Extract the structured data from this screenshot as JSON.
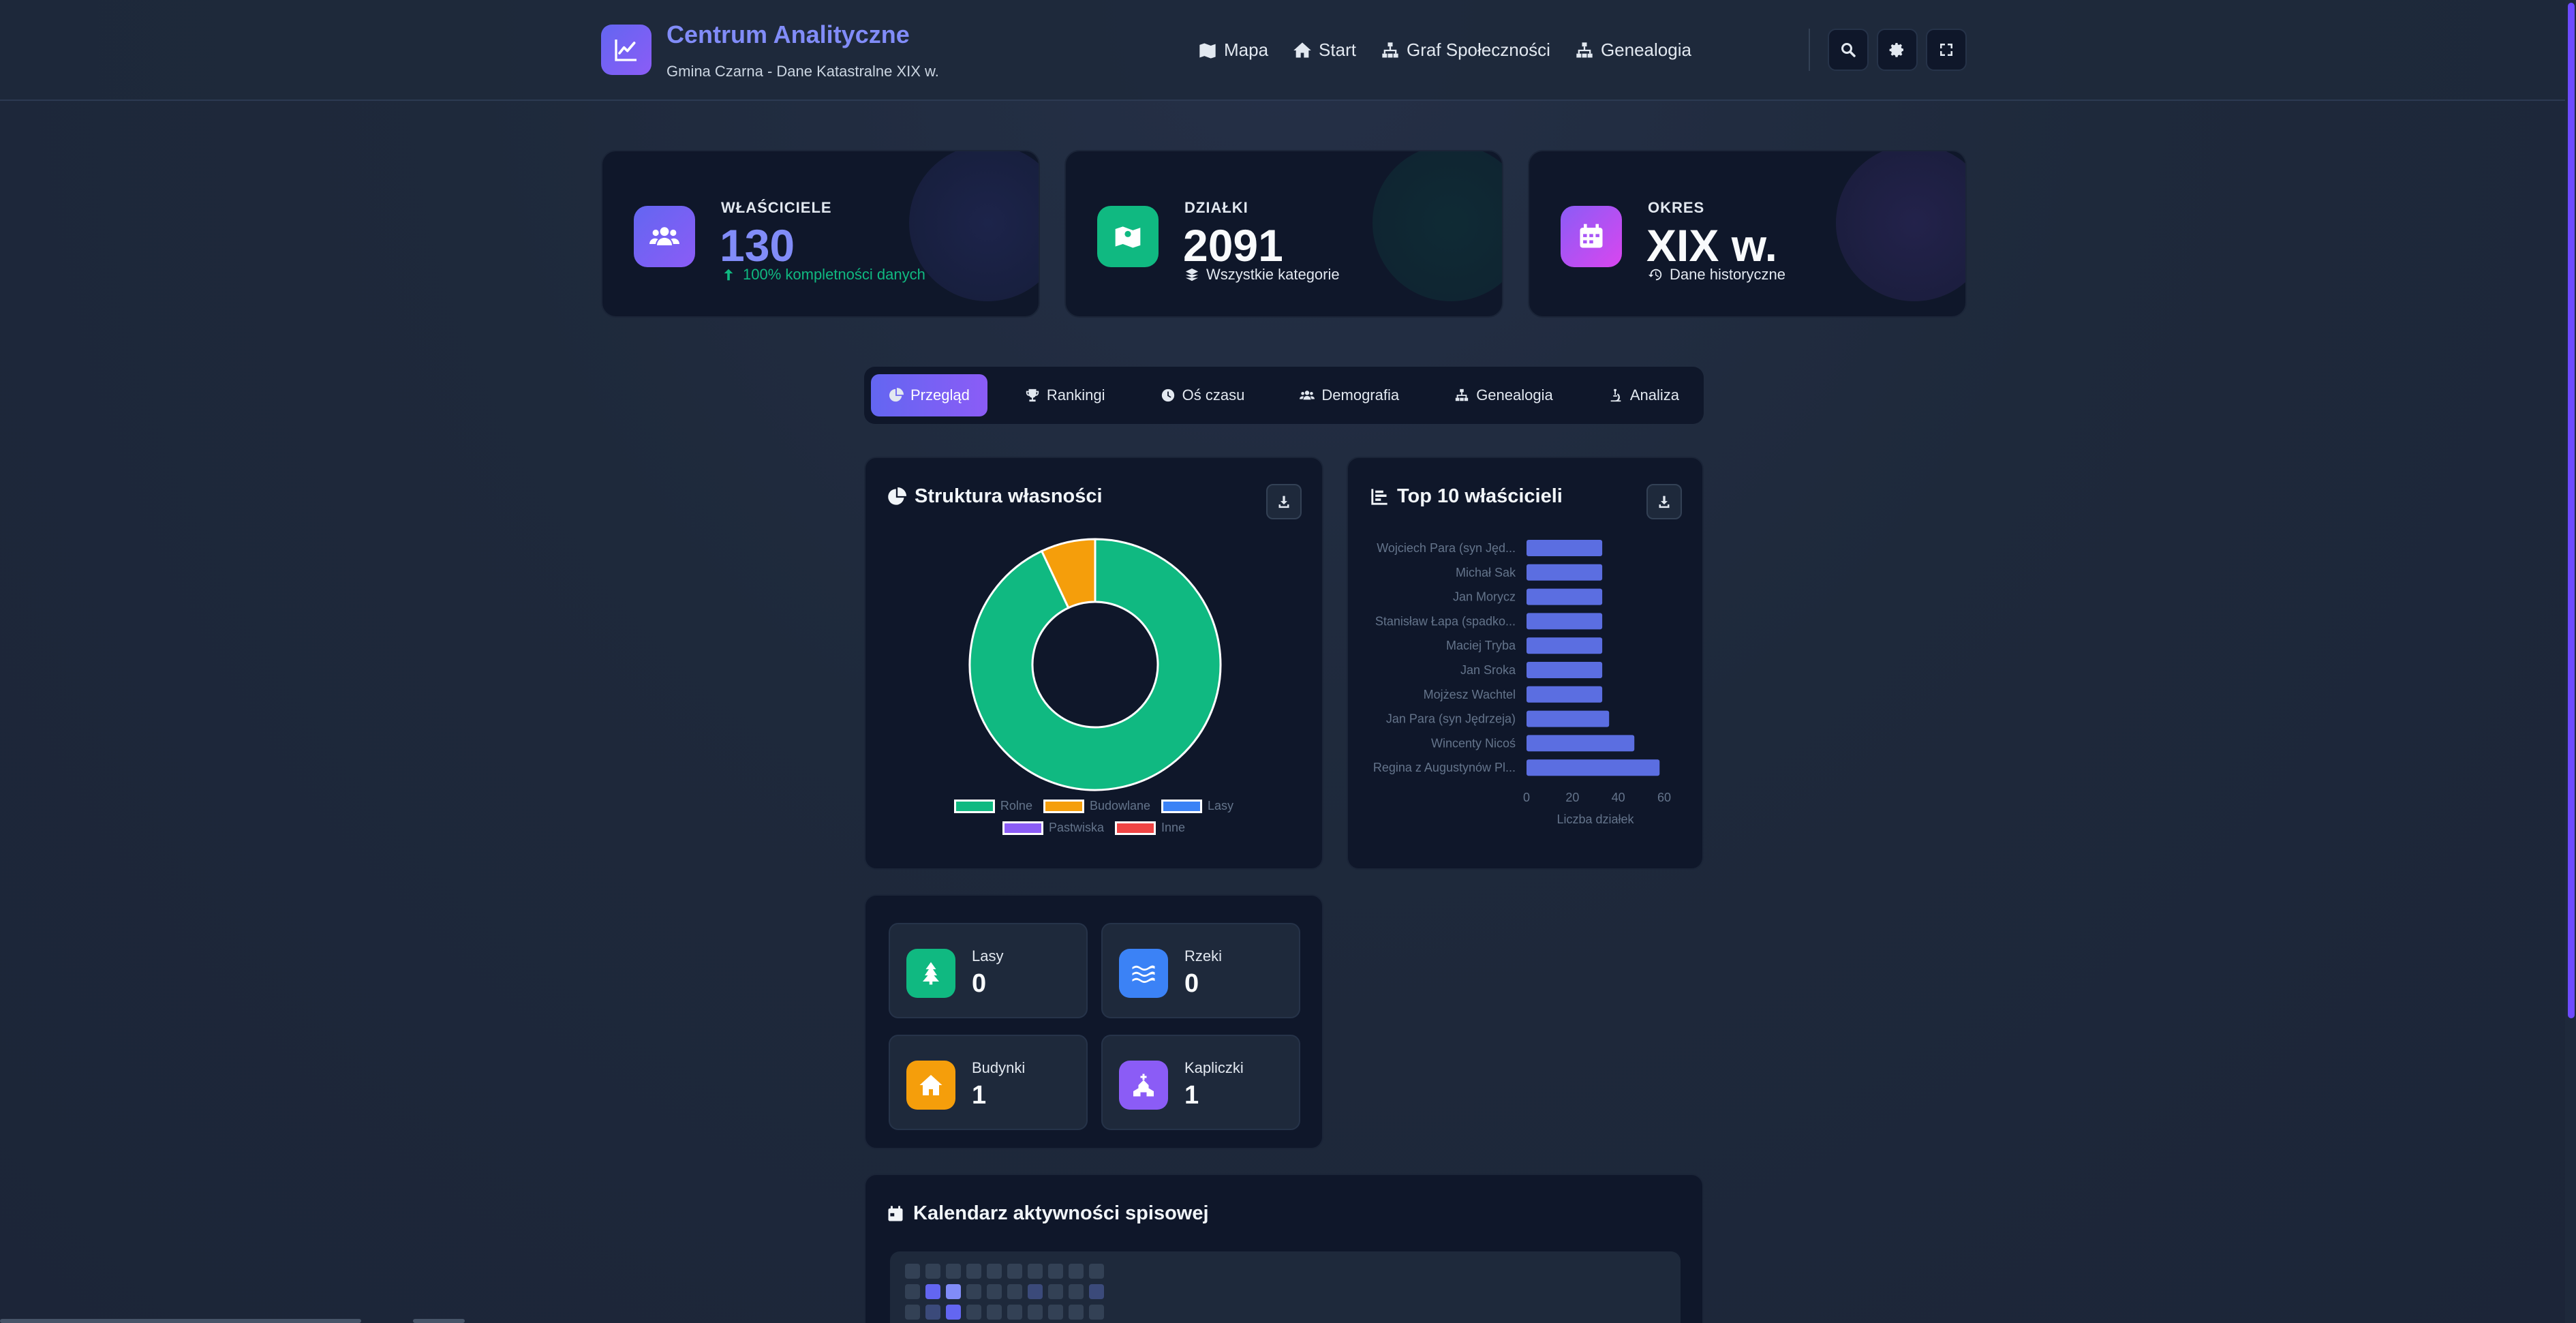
{
  "header": {
    "title": "Centrum Analityczne",
    "subtitle": "Gmina Czarna - Dane Katastralne XIX w.",
    "nav": [
      {
        "label": "Mapa",
        "icon": "map-icon"
      },
      {
        "label": "Start",
        "icon": "home-icon"
      },
      {
        "label": "Graf Społeczności",
        "icon": "sitemap-icon"
      },
      {
        "label": "Genealogia",
        "icon": "sitemap-icon"
      }
    ],
    "tools": [
      "search-icon",
      "gear-icon",
      "fullscreen-icon"
    ]
  },
  "stats": [
    {
      "label": "WŁAŚCICIELE",
      "value": "130",
      "sub": "100% kompletności danych",
      "accent": "#6366f1",
      "value_color": "#818cf8",
      "sub_color": "#10b981"
    },
    {
      "label": "DZIAŁKI",
      "value": "2091",
      "sub": "Wszystkie kategorie",
      "accent": "#10b981",
      "value_color": "#f8fafc",
      "sub_color": "#e2e8f0"
    },
    {
      "label": "OKRES",
      "value": "XIX w.",
      "sub": "Dane historyczne",
      "accent": "#8b5cf6",
      "value_color": "#f8fafc",
      "sub_color": "#e2e8f0"
    }
  ],
  "tabs": [
    {
      "label": "Przegląd",
      "active": true
    },
    {
      "label": "Rankingi",
      "active": false
    },
    {
      "label": "Oś czasu",
      "active": false
    },
    {
      "label": "Demografia",
      "active": false
    },
    {
      "label": "Genealogia",
      "active": false
    },
    {
      "label": "Analiza",
      "active": false
    }
  ],
  "ownership_panel": {
    "title": "Struktura własności"
  },
  "top_panel": {
    "title": "Top 10 właścicieli"
  },
  "chart_data": [
    {
      "type": "pie",
      "title": "Struktura własności",
      "categories": [
        "Rolne",
        "Budowlane",
        "Lasy",
        "Pastwiska",
        "Inne"
      ],
      "values": [
        93,
        7,
        0,
        0,
        0
      ],
      "colors": [
        "#10b981",
        "#f59e0b",
        "#3b82f6",
        "#8b5cf6",
        "#ef4444"
      ],
      "legend": "bottom"
    },
    {
      "type": "bar",
      "title": "Top 10 właścicieli",
      "orientation": "horizontal",
      "categories": [
        "Wojciech Para (syn Jęd...",
        "Michał Sak",
        "Jan Morycz",
        "Stanisław Łapa (spadko...",
        "Maciej Tryba",
        "Jan Sroka",
        "Mojżesz Wachtel",
        "Jan Para (syn Jędrzeja)",
        "Wincenty Nicoś",
        "Regina z Augustynów Pl..."
      ],
      "values": [
        33,
        33,
        33,
        33,
        33,
        33,
        33,
        36,
        47,
        58
      ],
      "xlabel": "Liczba działek",
      "xticks": [
        0,
        20,
        40,
        60
      ],
      "xlim": [
        0,
        60
      ],
      "color": "#5b6ee1"
    }
  ],
  "features": [
    {
      "label": "Lasy",
      "value": "0",
      "icon": "tree-icon",
      "color": "#10b981"
    },
    {
      "label": "Rzeki",
      "value": "0",
      "icon": "water-icon",
      "color": "#3b82f6"
    },
    {
      "label": "Budynki",
      "value": "1",
      "icon": "house-icon",
      "color": "#f59e0b"
    },
    {
      "label": "Kapliczki",
      "value": "1",
      "icon": "church-icon",
      "color": "#8b5cf6"
    }
  ],
  "calendar": {
    "title": "Kalendarz aktywności spisowej"
  }
}
